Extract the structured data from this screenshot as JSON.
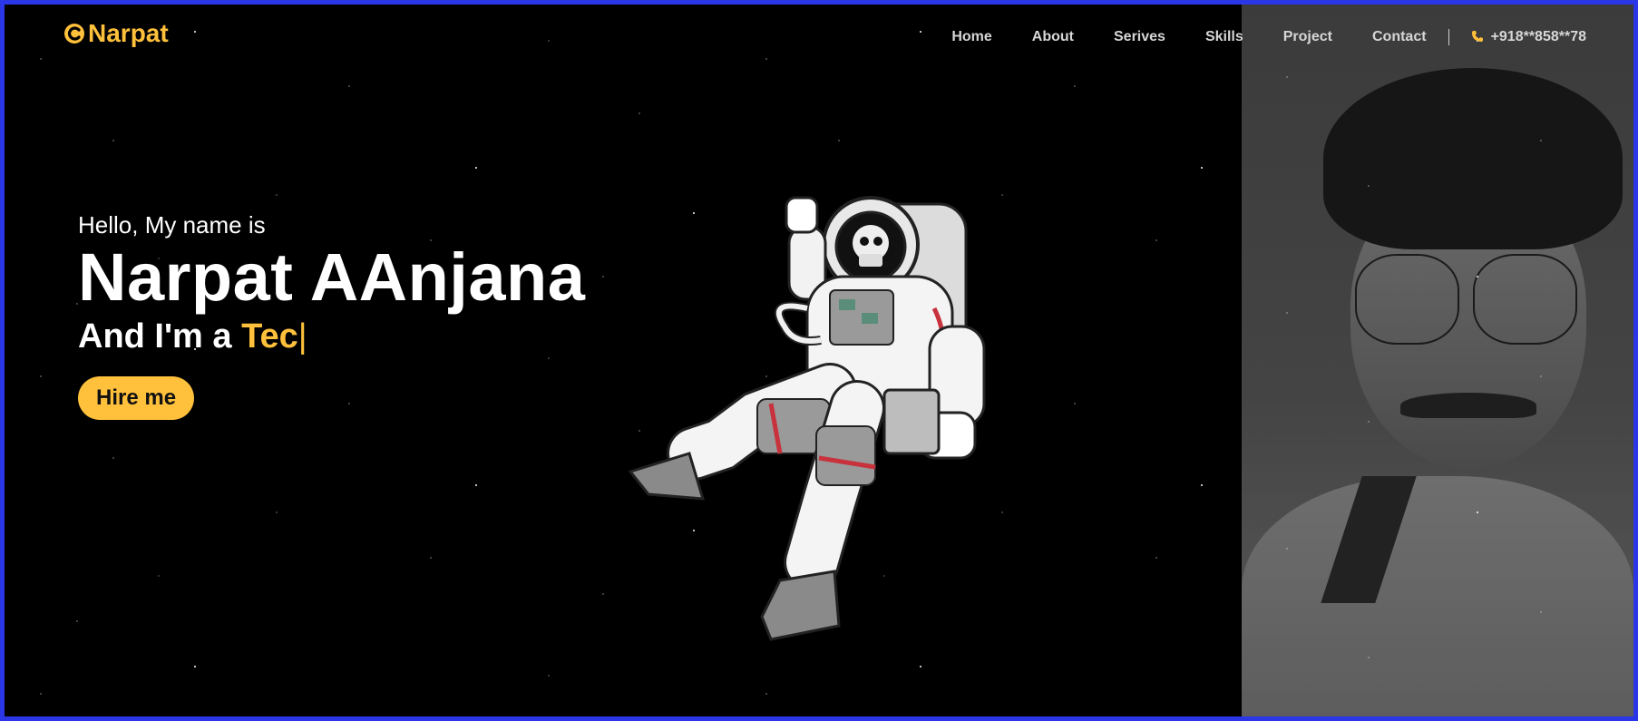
{
  "brand": {
    "name": "Narpat",
    "icon": "c-logo-icon",
    "color": "#ffc03b"
  },
  "nav": {
    "items": [
      {
        "label": "Home"
      },
      {
        "label": "About"
      },
      {
        "label": "Serives"
      },
      {
        "label": "Skills"
      },
      {
        "label": "Project"
      },
      {
        "label": "Contact"
      }
    ],
    "phone": "+918**858**78",
    "phone_icon": "phone-icon"
  },
  "hero": {
    "greeting": "Hello, My name is",
    "name": "Narpat AAnjana",
    "role_prefix": "And I'm a",
    "role_typed": "Tec",
    "caret": "|",
    "cta_label": "Hire me"
  },
  "colors": {
    "accent": "#ffc03b",
    "background": "#000000",
    "frame": "#2b36e6"
  }
}
